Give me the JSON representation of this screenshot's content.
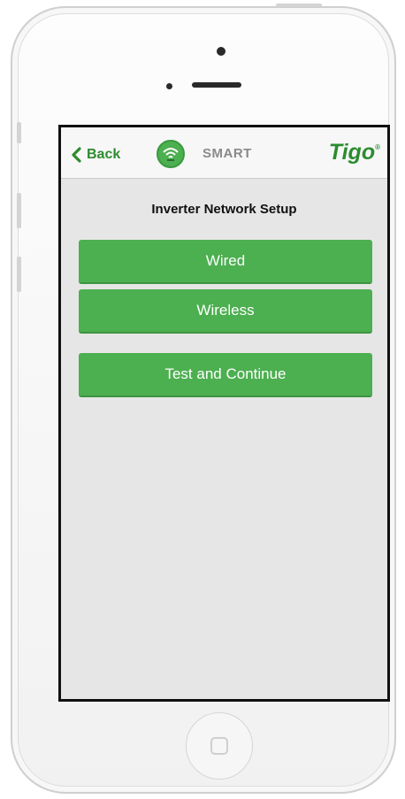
{
  "navbar": {
    "back_label": "Back",
    "app_label": "SMART",
    "logo_text": "Tigo",
    "logo_mark": "®"
  },
  "page": {
    "title": "Inverter Network Setup"
  },
  "buttons": [
    {
      "label": "Wired"
    },
    {
      "label": "Wireless"
    },
    {
      "label": "Test and Continue"
    }
  ],
  "colors": {
    "accent": "#4caf50",
    "brand": "#2a8c2f",
    "background": "#e6e6e6"
  },
  "icons": {
    "back": "chevron-left-icon",
    "app": "wifi-icon",
    "home": "home-button-icon"
  }
}
